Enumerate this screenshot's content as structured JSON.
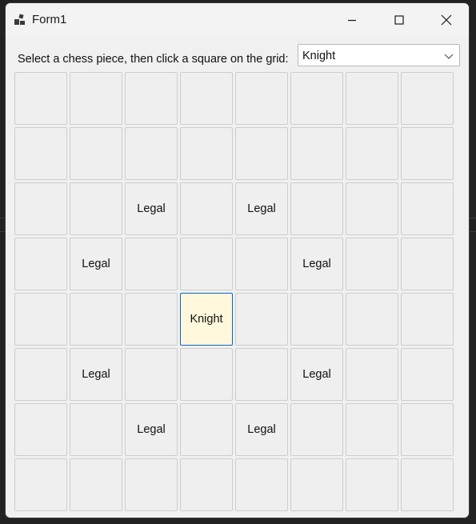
{
  "window": {
    "title": "Form1"
  },
  "prompt": "Select a chess piece, then click a square on the grid:",
  "piece_select": {
    "selected": "Knight"
  },
  "board": {
    "rows": [
      [
        "",
        "",
        "",
        "",
        "",
        "",
        "",
        ""
      ],
      [
        "",
        "",
        "",
        "",
        "",
        "",
        "",
        ""
      ],
      [
        "",
        "",
        "Legal",
        "",
        "Legal",
        "",
        "",
        ""
      ],
      [
        "",
        "Legal",
        "",
        "",
        "",
        "Legal",
        "",
        ""
      ],
      [
        "",
        "",
        "",
        "Knight",
        "",
        "",
        "",
        ""
      ],
      [
        "",
        "Legal",
        "",
        "",
        "",
        "Legal",
        "",
        ""
      ],
      [
        "",
        "",
        "Legal",
        "",
        "Legal",
        "",
        "",
        ""
      ],
      [
        "",
        "",
        "",
        "",
        "",
        "",
        "",
        ""
      ]
    ],
    "selected_square": {
      "row": 4,
      "col": 3
    }
  }
}
